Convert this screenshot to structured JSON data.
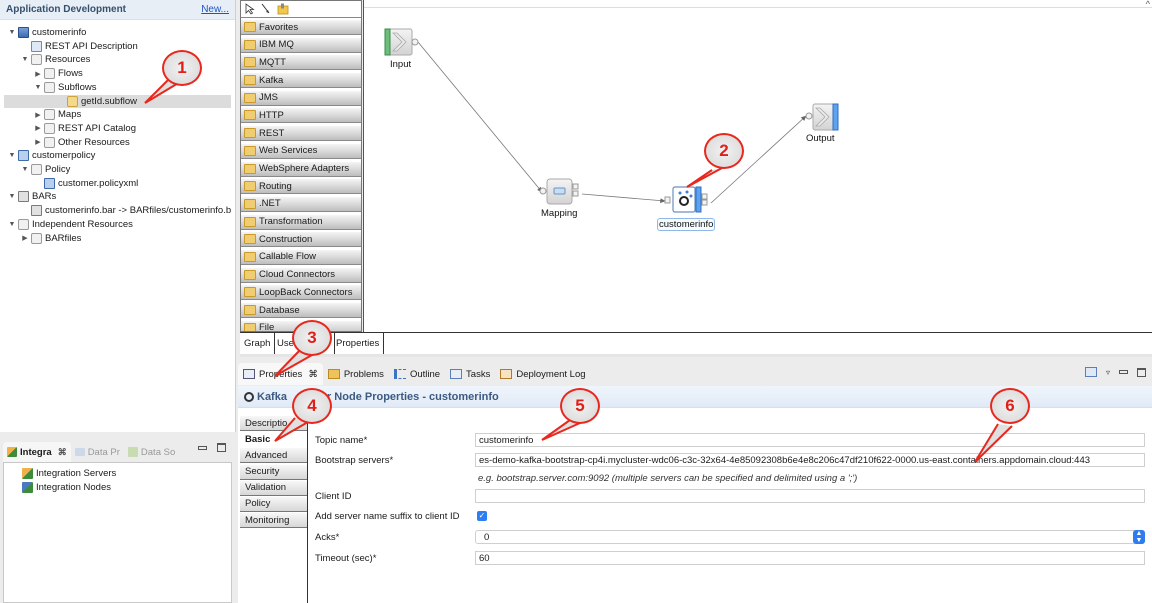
{
  "app_dev": {
    "title": "Application Development",
    "new_link": "New...",
    "tree": [
      {
        "label": "customerinfo",
        "level": 0,
        "twisty": "open",
        "icon": "project-icon"
      },
      {
        "label": "REST API Description",
        "level": 1,
        "twisty": "none",
        "icon": "rest-api-description-icon"
      },
      {
        "label": "Resources",
        "level": 1,
        "twisty": "open",
        "icon": "folder-icon"
      },
      {
        "label": "Flows",
        "level": 2,
        "twisty": "closed",
        "icon": "folder-icon"
      },
      {
        "label": "Subflows",
        "level": 2,
        "twisty": "open",
        "icon": "folder-icon"
      },
      {
        "label": "getId.subflow",
        "level": 3,
        "twisty": "none",
        "icon": "subflow-icon",
        "selected": true
      },
      {
        "label": "Maps",
        "level": 2,
        "twisty": "closed",
        "icon": "folder-icon"
      },
      {
        "label": "REST API Catalog",
        "level": 2,
        "twisty": "closed",
        "icon": "folder-icon"
      },
      {
        "label": "Other Resources",
        "level": 2,
        "twisty": "closed",
        "icon": "folder-icon"
      },
      {
        "label": "customerpolicy",
        "level": 0,
        "twisty": "open",
        "icon": "policy-project-icon"
      },
      {
        "label": "Policy",
        "level": 1,
        "twisty": "open",
        "icon": "folder-icon"
      },
      {
        "label": "customer.policyxml",
        "level": 2,
        "twisty": "none",
        "icon": "policy-file-icon"
      },
      {
        "label": "BARs",
        "level": 0,
        "twisty": "open",
        "icon": "bars-icon"
      },
      {
        "label": "customerinfo.bar -> BARfiles/customerinfo.b",
        "level": 1,
        "twisty": "none",
        "icon": "bar-file-icon"
      },
      {
        "label": "Independent Resources",
        "level": 0,
        "twisty": "open",
        "icon": "folder-icon"
      },
      {
        "label": "BARfiles",
        "level": 1,
        "twisty": "closed",
        "icon": "folder-icon"
      }
    ]
  },
  "integration": {
    "tabs": [
      {
        "label": "Integra",
        "active": true,
        "close": "⌘"
      },
      {
        "label": "Data Pr",
        "active": false
      },
      {
        "label": "Data So",
        "active": false
      }
    ],
    "items": [
      "Integration Servers",
      "Integration Nodes"
    ]
  },
  "palette": {
    "groups": [
      "Favorites",
      "IBM MQ",
      "MQTT",
      "Kafka",
      "JMS",
      "HTTP",
      "REST",
      "Web Services",
      "WebSphere Adapters",
      "Routing",
      ".NET",
      "Transformation",
      "Construction",
      "Callable Flow",
      "Cloud Connectors",
      "LoopBack Connectors",
      "Database",
      "File"
    ]
  },
  "flow": {
    "nodes": [
      {
        "id": "input",
        "label": "Input"
      },
      {
        "id": "mapping",
        "label": "Mapping"
      },
      {
        "id": "customerinfo",
        "label": "customerinfo"
      },
      {
        "id": "output",
        "label": "Output"
      }
    ]
  },
  "editor_tabs": [
    "Graph",
    "User Defined Properties",
    "Properties"
  ],
  "editor_tabs_visible": [
    "Graph",
    "Use",
    "Properties"
  ],
  "view_tabs": [
    {
      "label": "Properties",
      "active": true,
      "close": "⌘"
    },
    {
      "label": "Problems"
    },
    {
      "label": "Outline"
    },
    {
      "label": "Tasks"
    },
    {
      "label": "Deployment Log"
    }
  ],
  "properties": {
    "header": "KafkaProducer Node Properties - customerinfo",
    "header_left": "Kafka",
    "header_right": "r Node Properties - customerinfo",
    "side_tabs": [
      "Description",
      "Basic",
      "Advanced",
      "Security",
      "Validation",
      "Policy",
      "Monitoring"
    ],
    "side_tabs_visible": [
      "Descriptio",
      "Basic",
      "Advanced",
      "Security",
      "Validation",
      "Policy",
      "Monitoring"
    ],
    "active_tab": "Basic",
    "fields": {
      "topic_label": "Topic name*",
      "topic_value": "customerinfo",
      "bootstrap_label": "Bootstrap servers*",
      "bootstrap_value": "es-demo-kafka-bootstrap-cp4i.mycluster-wdc06-c3c-32x64-4e85092308b6e4e8c206c47df210f622-0000.us-east.containers.appdomain.cloud:443",
      "bootstrap_hint": "e.g. bootstrap.server.com:9092 (multiple servers can be specified and delimited using a ';')",
      "client_id_label": "Client ID",
      "client_id_value": "",
      "suffix_label": "Add server name suffix to client ID",
      "suffix_checked": true,
      "acks_label": "Acks*",
      "acks_value": "0",
      "timeout_label": "Timeout (sec)*",
      "timeout_value": "60"
    }
  },
  "callouts": [
    "1",
    "2",
    "3",
    "4",
    "5",
    "6"
  ],
  "colors": {
    "callout_red": "#e8271d",
    "accent_blue": "#2f7cf0",
    "header_text": "#3c5a82"
  }
}
